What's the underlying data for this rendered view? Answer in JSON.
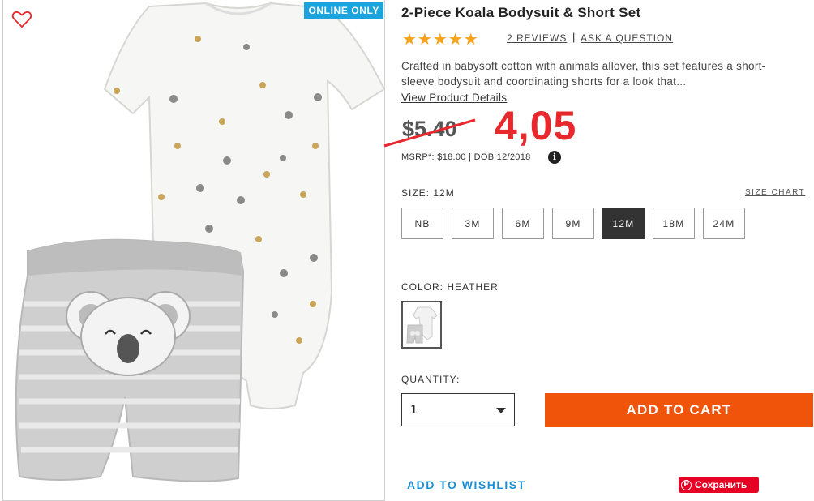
{
  "badge": "ONLINE ONLY",
  "product": {
    "title": "2-Piece Koala Bodysuit & Short Set",
    "rating_stars": "★★★★★",
    "reviews_label": "2 REVIEWS",
    "separator": "|",
    "ask_label": "ASK A QUESTION",
    "description": "Crafted in babysoft cotton with animals allover, this set features a short-sleeve bodysuit and coordinating shorts for a look that...",
    "view_details_label": "View Product Details"
  },
  "price": {
    "old": "$5.40",
    "new": "4,05",
    "msrp_line": "MSRP*: $18.00 | DOB 12/2018",
    "info_icon": "i"
  },
  "size": {
    "label": "SIZE: 12M",
    "chart_label": "SIZE CHART",
    "options": [
      "NB",
      "3M",
      "6M",
      "9M",
      "12M",
      "18M",
      "24M"
    ],
    "selected": "12M"
  },
  "color": {
    "label": "COLOR: HEATHER"
  },
  "quantity": {
    "label": "QUANTITY:",
    "value": "1"
  },
  "actions": {
    "add_to_cart": "ADD TO CART",
    "add_to_wishlist": "ADD TO WISHLIST",
    "pinterest_label": "Сохранить",
    "pinterest_icon": "P"
  },
  "colors": {
    "accent_orange": "#f0530a",
    "price_red": "#e8282d",
    "badge_blue": "#1aa3dc",
    "link_blue": "#1a8fd5",
    "star_orange": "#f7a21b",
    "pinterest_red": "#e60023"
  }
}
